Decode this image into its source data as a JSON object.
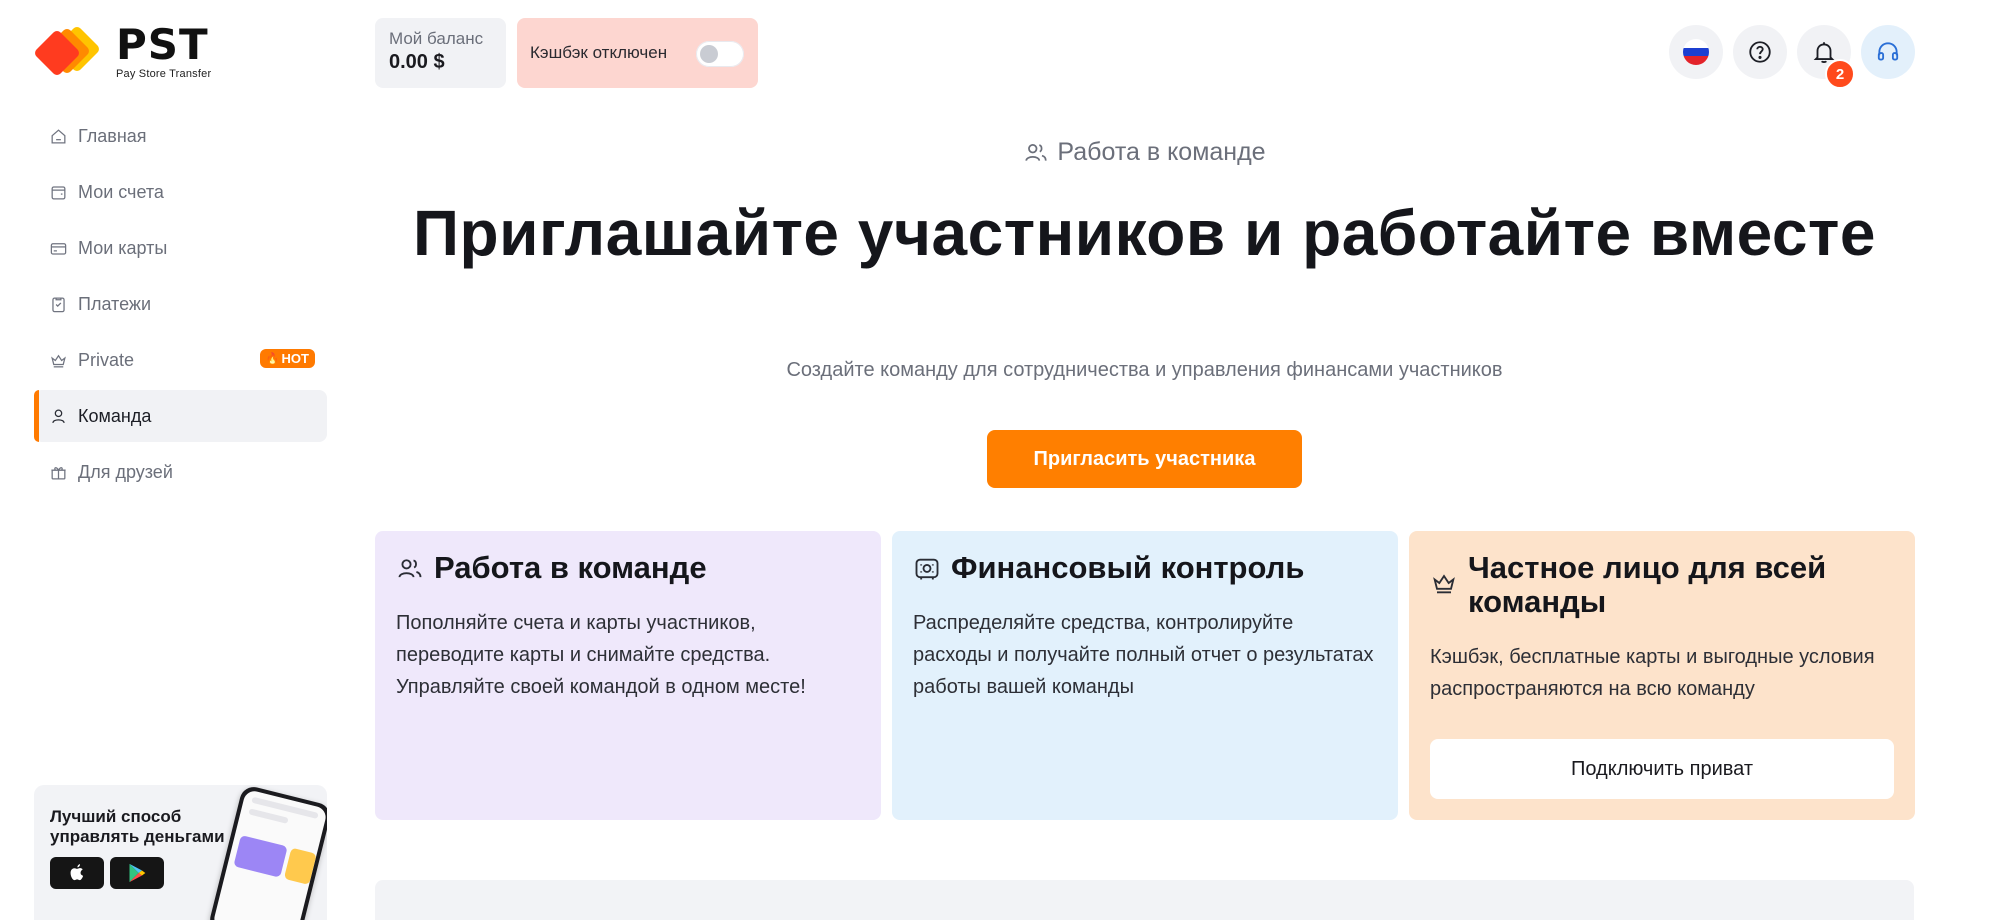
{
  "brand": {
    "name": "PST",
    "tagline": "Pay Store Transfer",
    "colors": {
      "primary": "#ff7f00",
      "logo_red": "#ff3b1f",
      "logo_orange": "#ff8a00",
      "logo_yellow": "#ffc400"
    }
  },
  "sidebar": {
    "items": [
      {
        "label": "Главная",
        "icon": "home-icon",
        "active": false
      },
      {
        "label": "Мои счета",
        "icon": "wallet-icon",
        "active": false
      },
      {
        "label": "Мои карты",
        "icon": "card-icon",
        "active": false
      },
      {
        "label": "Платежи",
        "icon": "payments-icon",
        "active": false
      },
      {
        "label": "Private",
        "icon": "crown-icon",
        "active": false,
        "badge": "HOT"
      },
      {
        "label": "Команда",
        "icon": "user-icon",
        "active": true
      },
      {
        "label": "Для друзей",
        "icon": "gift-icon",
        "active": false
      }
    ],
    "promo": {
      "text": "Лучший способ управлять деньгами",
      "stores": [
        "apple-store-icon",
        "google-play-icon"
      ]
    }
  },
  "topbar": {
    "balance_label": "Мой баланс",
    "balance_value": "0.00 $",
    "cashback_label": "Кэшбэк отключен",
    "cashback_enabled": false,
    "notifications_count": "2",
    "icons": [
      "russia-flag-icon",
      "help-icon",
      "bell-icon",
      "headset-icon"
    ]
  },
  "hero": {
    "tag": "Работа в команде",
    "title": "Приглашайте участников и работайте вместе",
    "subtitle": "Создайте команду для сотрудничества и управления финансами участников",
    "cta": "Пригласить участника"
  },
  "cards": [
    {
      "icon": "team-icon",
      "title": "Работа в команде",
      "text": "Пополняйте счета и карты участников, переводите карты и снимайте средства. Управляйте своей командой в одном месте!",
      "color": "#efe8fb"
    },
    {
      "icon": "finance-control-icon",
      "title": "Финансовый контроль",
      "text": "Распределяйте средства, контролируйте расходы и получайте полный отчет о результатах работы вашей команды",
      "color": "#e2f1fc"
    },
    {
      "icon": "crown-icon",
      "title": "Частное лицо для всей команды",
      "text": "Кэшбэк, бесплатные карты и выгодные условия распространяются на всю команду",
      "button": "Подключить приват",
      "color": "#fde3cb"
    }
  ]
}
